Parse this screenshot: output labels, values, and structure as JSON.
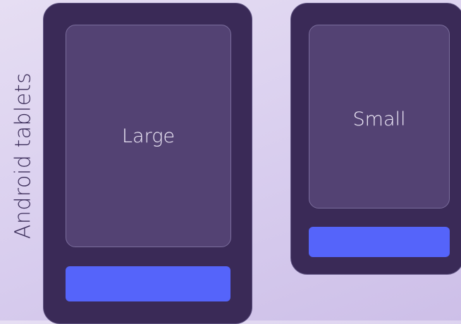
{
  "side_label": "Android tablets",
  "devices": [
    {
      "name": "large",
      "label": "Large"
    },
    {
      "name": "small",
      "label": "Small"
    }
  ],
  "colors": {
    "background": "#d8cdee",
    "device_body": "#3a2a57",
    "screen": "#534273",
    "bar": "#5564fa",
    "text_dark": "#3a2c58",
    "text_light": "#f1ecfa"
  }
}
